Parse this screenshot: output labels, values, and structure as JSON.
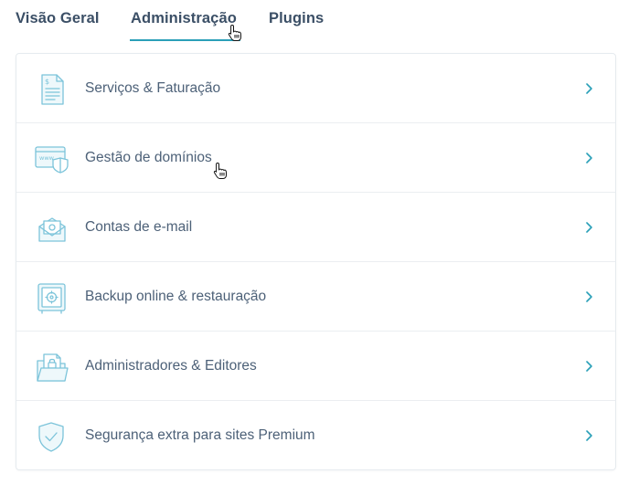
{
  "tabs": {
    "items": [
      {
        "label": "Visão Geral",
        "active": false
      },
      {
        "label": "Administração",
        "active": true
      },
      {
        "label": "Plugins",
        "active": false
      }
    ],
    "accent_color": "#2a9fb8"
  },
  "menu": {
    "items": [
      {
        "label": "Serviços & Faturação",
        "icon": "invoice-document-icon"
      },
      {
        "label": "Gestão de domínios",
        "icon": "www-domain-shield-icon"
      },
      {
        "label": "Contas de e-mail",
        "icon": "email-envelope-icon"
      },
      {
        "label": "Backup online & restauração",
        "icon": "backup-safe-icon"
      },
      {
        "label": "Administradores & Editores",
        "icon": "folder-lock-icon"
      },
      {
        "label": "Segurança extra para sites Premium",
        "icon": "security-shield-check-icon"
      }
    ],
    "chevron_icon": "chevron-right-icon",
    "icon_color": "#7cc4da",
    "chevron_color": "#2a9fb8",
    "text_color": "#4d6178"
  },
  "cursor_icon": "hand-pointer-icon"
}
